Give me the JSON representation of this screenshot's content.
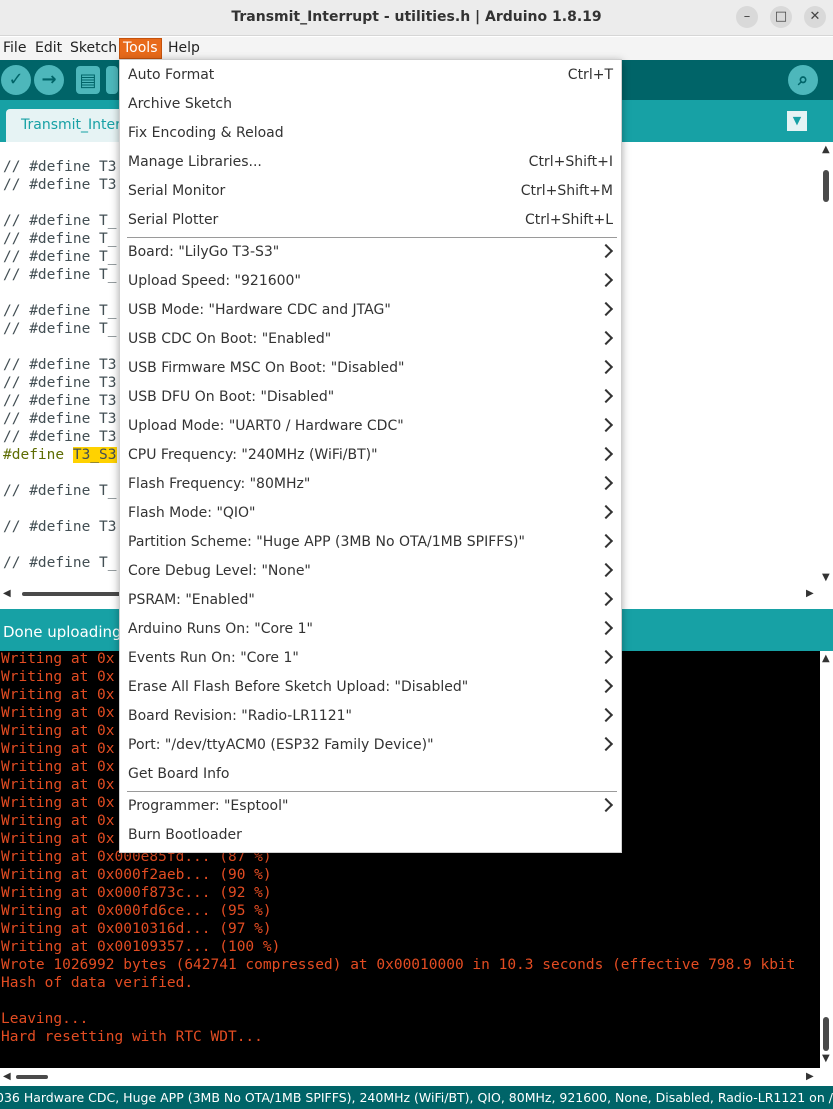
{
  "window": {
    "title": "Transmit_Interrupt - utilities.h | Arduino 1.8.19",
    "minimize_icon": "minimize-icon",
    "maximize_icon": "maximize-icon",
    "close_icon": "close-icon"
  },
  "menubar": {
    "items": [
      "File",
      "Edit",
      "Sketch",
      "Tools",
      "Help"
    ],
    "active": "Tools"
  },
  "toolbar": {
    "verify_icon": "check-icon",
    "upload_icon": "arrow-right-icon",
    "new_icon": "new-file-icon",
    "serial_monitor_icon": "magnifier-icon"
  },
  "tab": {
    "label": "Transmit_Interrupt"
  },
  "editor": {
    "lines": [
      "// #define T3",
      "// #define T3",
      "",
      "// #define T_",
      "// #define T_",
      "// #define T_",
      "// #define T_",
      "",
      "// #define T_",
      "// #define T_",
      "",
      "// #define T3",
      "// #define T3",
      "// #define T3",
      "// #define T3",
      "// #define T3",
      "",
      "// #define T_",
      "",
      "// #define T3",
      "",
      "// #define T_"
    ],
    "define_line": {
      "keyword": "#define",
      "highlighted": "T3_S3"
    }
  },
  "status": {
    "message": "Done uploading."
  },
  "console": {
    "lines": [
      "Writing at 0x",
      "Writing at 0x",
      "Writing at 0x",
      "Writing at 0x",
      "Writing at 0x",
      "Writing at 0x",
      "Writing at 0x",
      "Writing at 0x",
      "Writing at 0x",
      "Writing at 0x",
      "Writing at 0x",
      "Writing at 0x000e85fd... (87 %)",
      "Writing at 0x000f2aeb... (90 %)",
      "Writing at 0x000f873c... (92 %)",
      "Writing at 0x000fd6ce... (95 %)",
      "Writing at 0x0010316d... (97 %)",
      "Writing at 0x00109357... (100 %)",
      "Wrote 1026992 bytes (642741 compressed) at 0x00010000 in 10.3 seconds (effective 798.9 kbit",
      "Hash of data verified.",
      "",
      "Leaving...",
      "Hard resetting with RTC WDT..."
    ]
  },
  "bottom_status": "036 Hardware CDC, Huge APP (3MB No OTA/1MB SPIFFS), 240MHz (WiFi/BT), QIO, 80MHz, 921600, None, Disabled, Radio-LR1121 on /dev/ttyACM0",
  "tools_menu": {
    "group1": [
      {
        "label": "Auto Format",
        "shortcut": "Ctrl+T"
      },
      {
        "label": "Archive Sketch",
        "shortcut": ""
      },
      {
        "label": "Fix Encoding & Reload",
        "shortcut": ""
      },
      {
        "label": "Manage Libraries...",
        "shortcut": "Ctrl+Shift+I"
      },
      {
        "label": "Serial Monitor",
        "shortcut": "Ctrl+Shift+M"
      },
      {
        "label": "Serial Plotter",
        "shortcut": "Ctrl+Shift+L"
      }
    ],
    "group2": [
      {
        "label": "Board: \"LilyGo T3-S3\"",
        "submenu": true
      },
      {
        "label": "Upload Speed: \"921600\"",
        "submenu": true
      },
      {
        "label": "USB Mode: \"Hardware CDC and JTAG\"",
        "submenu": true
      },
      {
        "label": "USB CDC On Boot: \"Enabled\"",
        "submenu": true
      },
      {
        "label": "USB Firmware MSC On Boot: \"Disabled\"",
        "submenu": true
      },
      {
        "label": "USB DFU On Boot: \"Disabled\"",
        "submenu": true
      },
      {
        "label": "Upload Mode: \"UART0 / Hardware CDC\"",
        "submenu": true
      },
      {
        "label": "CPU Frequency: \"240MHz (WiFi/BT)\"",
        "submenu": true
      },
      {
        "label": "Flash Frequency: \"80MHz\"",
        "submenu": true
      },
      {
        "label": "Flash Mode: \"QIO\"",
        "submenu": true
      },
      {
        "label": "Partition Scheme: \"Huge APP (3MB No OTA/1MB SPIFFS)\"",
        "submenu": true
      },
      {
        "label": "Core Debug Level: \"None\"",
        "submenu": true
      },
      {
        "label": "PSRAM: \"Enabled\"",
        "submenu": true
      },
      {
        "label": "Arduino Runs On: \"Core 1\"",
        "submenu": true
      },
      {
        "label": "Events Run On: \"Core 1\"",
        "submenu": true
      },
      {
        "label": "Erase All Flash Before Sketch Upload: \"Disabled\"",
        "submenu": true
      },
      {
        "label": "Board Revision: \"Radio-LR1121\"",
        "submenu": true
      },
      {
        "label": "Port: \"/dev/ttyACM0 (ESP32 Family Device)\"",
        "submenu": true
      },
      {
        "label": "Get Board Info",
        "submenu": false
      }
    ],
    "group3": [
      {
        "label": "Programmer: \"Esptool\"",
        "submenu": true
      },
      {
        "label": "Burn Bootloader",
        "submenu": false
      }
    ]
  }
}
